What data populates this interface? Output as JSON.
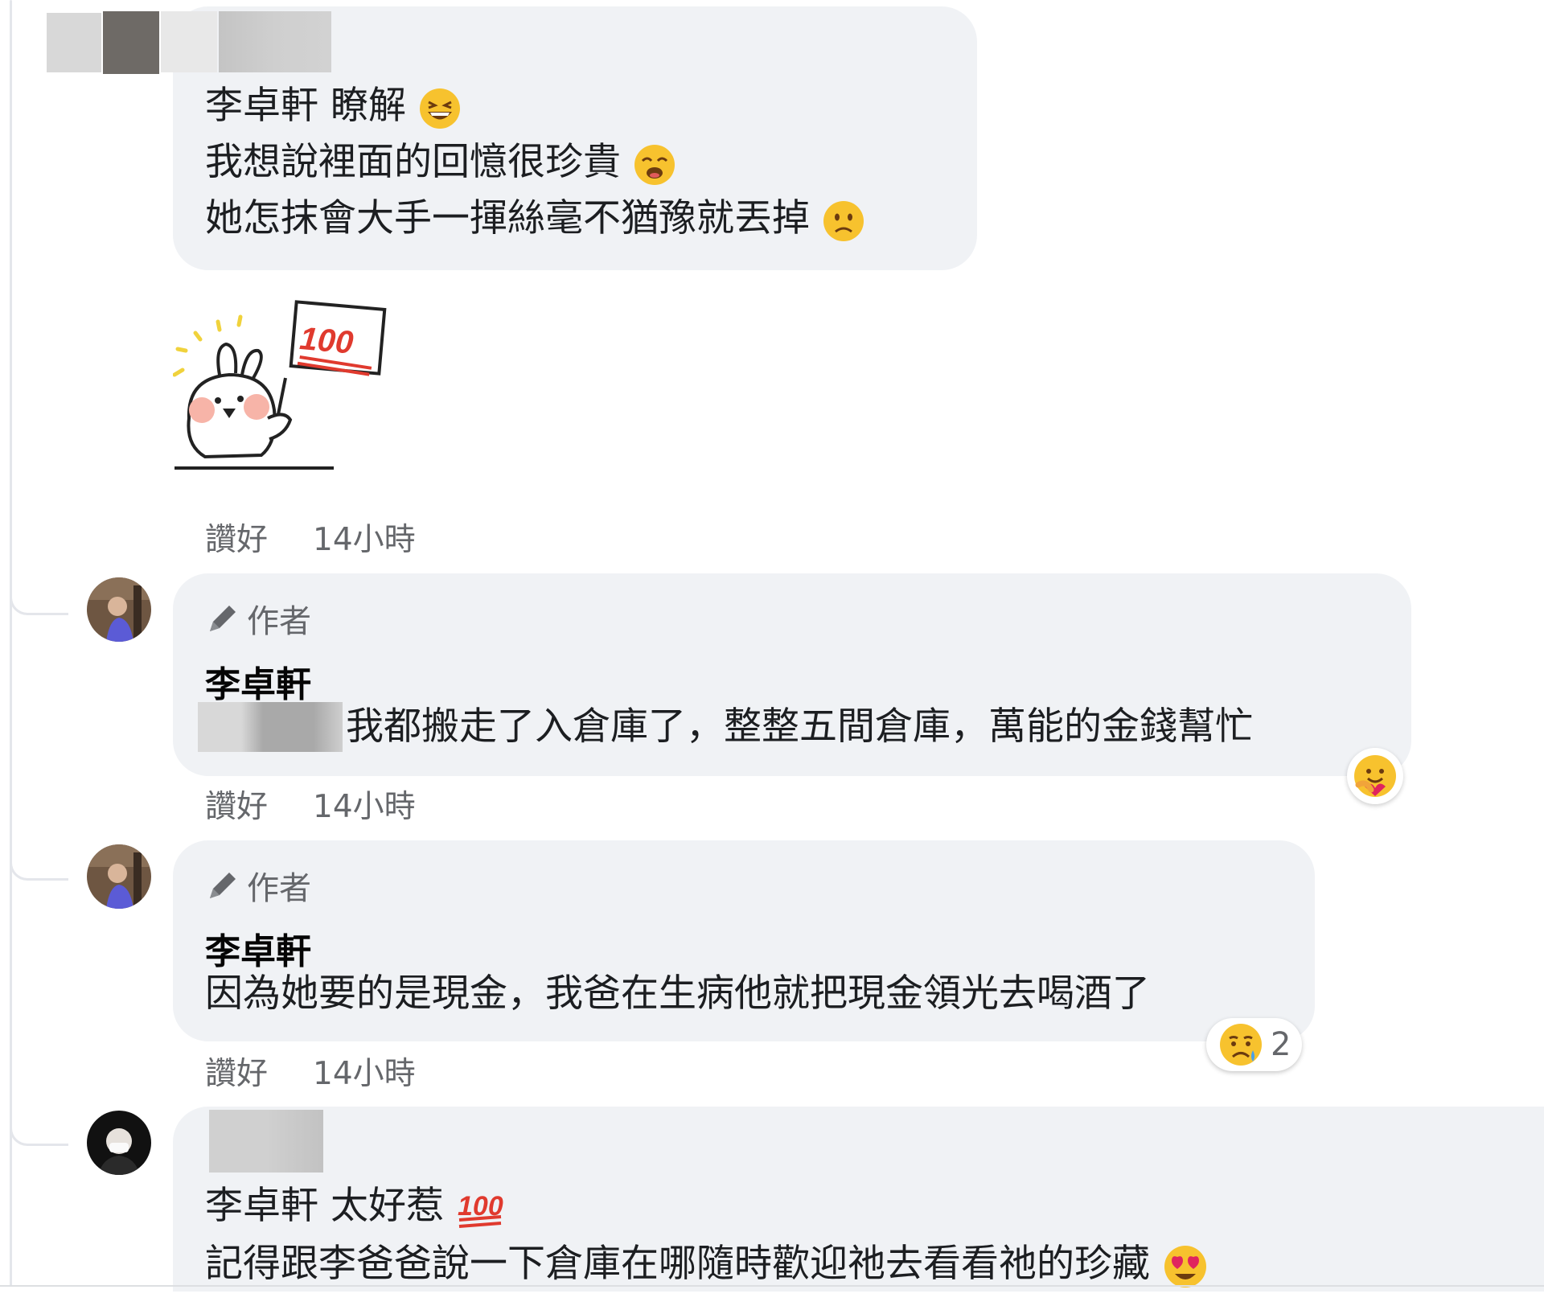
{
  "comments": [
    {
      "lines": [
        "李卓軒 瞭解",
        "我想說裡面的回憶很珍貴",
        "她怎抹會大手一揮絲毫不猶豫就丟掉"
      ],
      "sticker": {
        "sign_text": "100"
      },
      "actions": {
        "like": "讚好",
        "time": "14小時"
      }
    },
    {
      "badge": "作者",
      "author": "李卓軒",
      "text": "我都搬走了入倉庫了，整整五間倉庫，萬能的金錢幫忙",
      "actions": {
        "like": "讚好",
        "time": "14小時"
      }
    },
    {
      "badge": "作者",
      "author": "李卓軒",
      "text": "因為她要的是現金，我爸在生病他就把現金領光去喝酒了",
      "reaction_count": "2",
      "actions": {
        "like": "讚好",
        "time": "14小時"
      }
    },
    {
      "lines": [
        "李卓軒 太好惹",
        "記得跟李爸爸說一下倉庫在哪隨時歡迎祂去看看祂的珍藏"
      ]
    }
  ],
  "icons": {
    "pencil": "pencil-icon",
    "laugh": "grinning-squinting-face-icon",
    "weary": "weary-face-icon",
    "sad": "slightly-frowning-face-icon",
    "care": "care-reaction-icon",
    "cry": "sad-reaction-icon",
    "hundred": "hundred-points-icon",
    "heart_eyes": "heart-eyes-icon"
  },
  "colors": {
    "bubble": "#f0f2f5",
    "meta": "#65676b",
    "text": "#1c1e21"
  }
}
